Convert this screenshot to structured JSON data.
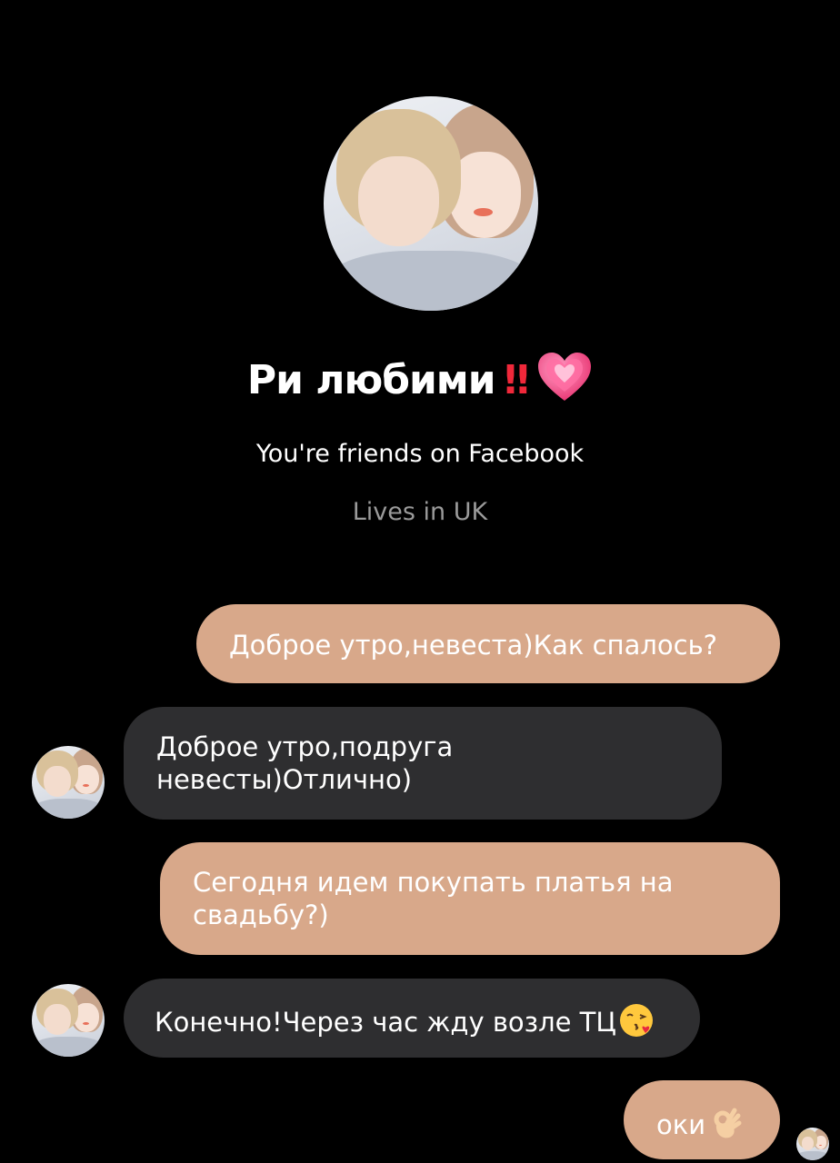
{
  "profile": {
    "photo_alt": "avatar",
    "name": "Ри любими",
    "name_emojis": [
      "‼️",
      "💗"
    ],
    "name_bang": "‼",
    "friends_text": "You're friends on Facebook",
    "location_text": "Lives in UK"
  },
  "messages": [
    {
      "direction": "sent",
      "text": "Доброе утро,невеста)Как спалось?"
    },
    {
      "direction": "received",
      "line1": "Доброе утро,подруга",
      "line2": "невесты)Отлично)"
    },
    {
      "direction": "sent",
      "line1": "Сегодня идем покупать платья на",
      "line2": "свадьбу?)"
    },
    {
      "direction": "received",
      "text": "Конечно!Через час жду возле ТЦ",
      "emoji": "face-blowing-a-kiss"
    },
    {
      "direction": "sent",
      "text": "оки",
      "emoji": "ok-hand"
    }
  ],
  "colors": {
    "background": "#000000",
    "sent_bubble": "#d8a88a",
    "received_bubble": "#2e2e30",
    "secondary_text": "#9a9a9a"
  }
}
